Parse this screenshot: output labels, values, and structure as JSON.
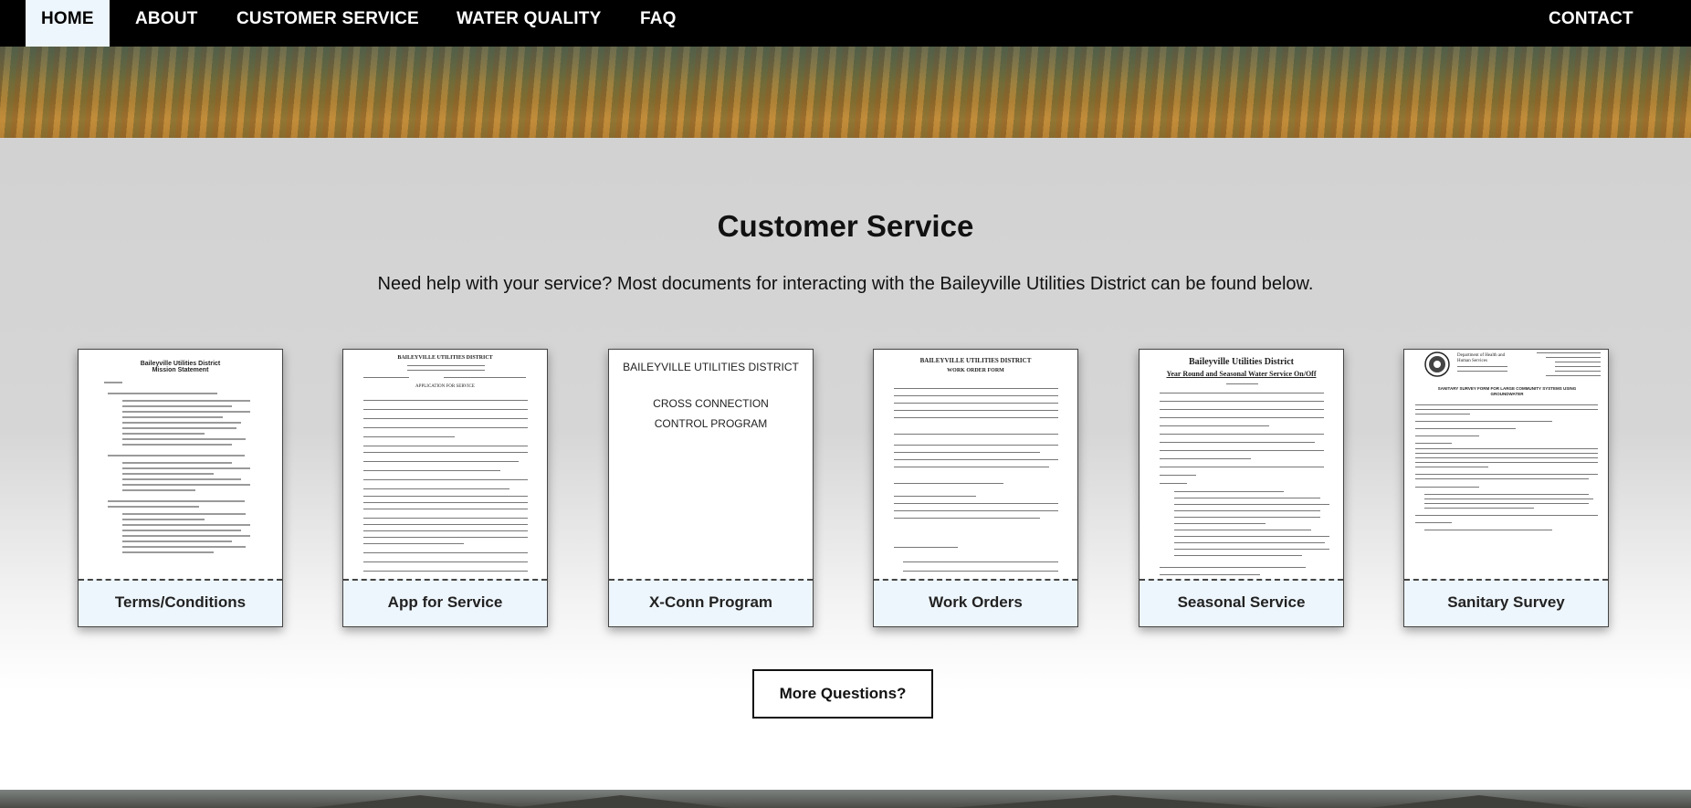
{
  "nav": {
    "items": [
      {
        "label": "HOME",
        "active": true
      },
      {
        "label": "ABOUT"
      },
      {
        "label": "CUSTOMER SERVICE"
      },
      {
        "label": "WATER QUALITY"
      },
      {
        "label": "FAQ"
      }
    ],
    "contact": "CONTACT"
  },
  "page": {
    "title": "Customer Service",
    "intro": "Need help with your service? Most documents for interacting with the Baileyville Utilities District can be found below."
  },
  "cards": [
    {
      "label": "Terms/Conditions",
      "doc_title": "Baileyville Utilities District",
      "doc_subtitle": "Mission Statement"
    },
    {
      "label": "App for Service",
      "doc_title": "BAILEYVILLE UTILITIES DISTRICT",
      "doc_subtitle": "APPLICATION FOR SERVICE"
    },
    {
      "label": "X-Conn Program",
      "doc_title": "BAILEYVILLE UTILITIES DISTRICT",
      "doc_line1": "CROSS CONNECTION",
      "doc_line2": "CONTROL PROGRAM"
    },
    {
      "label": "Work Orders",
      "doc_title": "BAILEYVILLE UTILITIES DISTRICT",
      "doc_subtitle": "WORK ORDER FORM"
    },
    {
      "label": "Seasonal Service",
      "doc_title": "Baileyville Utilities District",
      "doc_subtitle": "Year Round and Seasonal Water Service On/Off"
    },
    {
      "label": "Sanitary Survey",
      "doc_title": "Department of Health and Human Services",
      "doc_subtitle": "SANITARY SURVEY FORM FOR LARGE COMMUNITY SYSTEMS USING GROUNDWATER"
    }
  ],
  "more_button": "More Questions?"
}
